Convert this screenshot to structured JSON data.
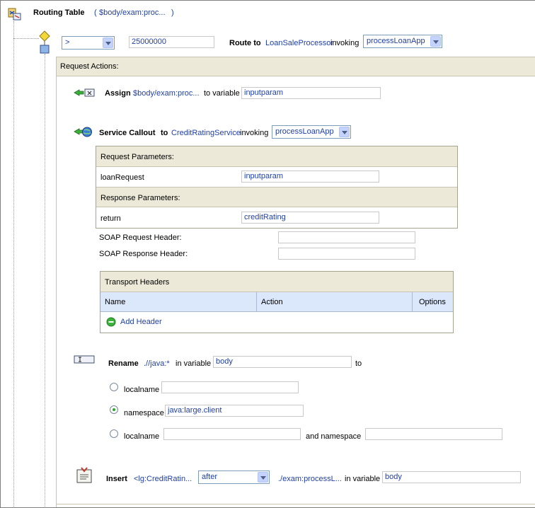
{
  "routing_table": {
    "title": "Routing Table",
    "expr_open": "(",
    "expr": "$body/exam:proc...",
    "expr_close": ")"
  },
  "case_row": {
    "operator": ">",
    "value": "25000000",
    "route_to_label": "Route to",
    "service": "LoanSaleProcessor",
    "invoking_label": "invoking",
    "operation": "processLoanApp"
  },
  "request_actions": {
    "label": "Request Actions:"
  },
  "assign": {
    "label": "Assign",
    "expr": "$body/exam:proc...",
    "to_variable_label": "to variable",
    "variable": "inputparam"
  },
  "service_callout": {
    "label": "Service Callout",
    "to_label": "to",
    "service": "CreditRatingService",
    "invoking_label": "invoking",
    "operation": "processLoanApp",
    "request_params_label": "Request Parameters:",
    "request_param_name": "loanRequest",
    "request_param_value": "inputparam",
    "response_params_label": "Response Parameters:",
    "response_param_name": "return",
    "response_param_value": "creditRating",
    "soap_request_header_label": "SOAP Request Header:",
    "soap_request_header_value": "",
    "soap_response_header_label": "SOAP Response Header:",
    "soap_response_header_value": ""
  },
  "transport_headers": {
    "title": "Transport Headers",
    "col_name": "Name",
    "col_action": "Action",
    "col_options": "Options",
    "add_header": "Add Header"
  },
  "rename": {
    "label": "Rename",
    "expr": ".//java:*",
    "in_variable_label": "in variable",
    "variable": "body",
    "to_label": "to",
    "opt1_label": "localname",
    "opt1_value": "",
    "opt2_label": "namespace",
    "opt2_value": "java:large.client",
    "opt3_label": "localname",
    "opt3_value": "",
    "and_namespace_label": "and namespace",
    "opt3_ns_value": ""
  },
  "insert": {
    "label": "Insert",
    "expr": "<lg:CreditRatin...",
    "position": "after",
    "target": "./exam:processL...",
    "in_variable_label": "in variable",
    "variable": "body"
  },
  "colors": {
    "link": "#1f3fa8",
    "band": "#ece9d8",
    "table_header": "#dbe7fb",
    "accent_green": "#22aa22"
  }
}
